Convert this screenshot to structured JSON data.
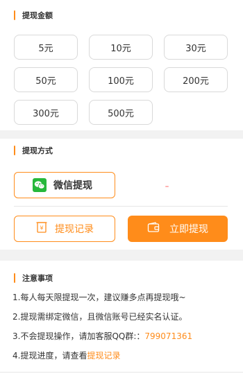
{
  "amount_section": {
    "title": "提现金额",
    "options": [
      "5元",
      "10元",
      "30元",
      "50元",
      "100元",
      "200元",
      "300元",
      "500元"
    ]
  },
  "method_section": {
    "title": "提现方式",
    "wechat_label": "微信提现"
  },
  "actions": {
    "record_label": "提现记录",
    "withdraw_label": "立即提现"
  },
  "notes_section": {
    "title": "注意事项",
    "items": [
      "1.每人每天限提现一次，建议赚多点再提现哦~",
      "2.提现需绑定微信，且微信账号已经实名认证。",
      "3.不会提现操作，请加客服QQ群:：",
      "4.提现进度，请查看"
    ],
    "qq_group": "799071361",
    "record_link": "提现记录"
  },
  "colors": {
    "accent": "#ff8c1a",
    "wechat_green": "#26b83b"
  }
}
